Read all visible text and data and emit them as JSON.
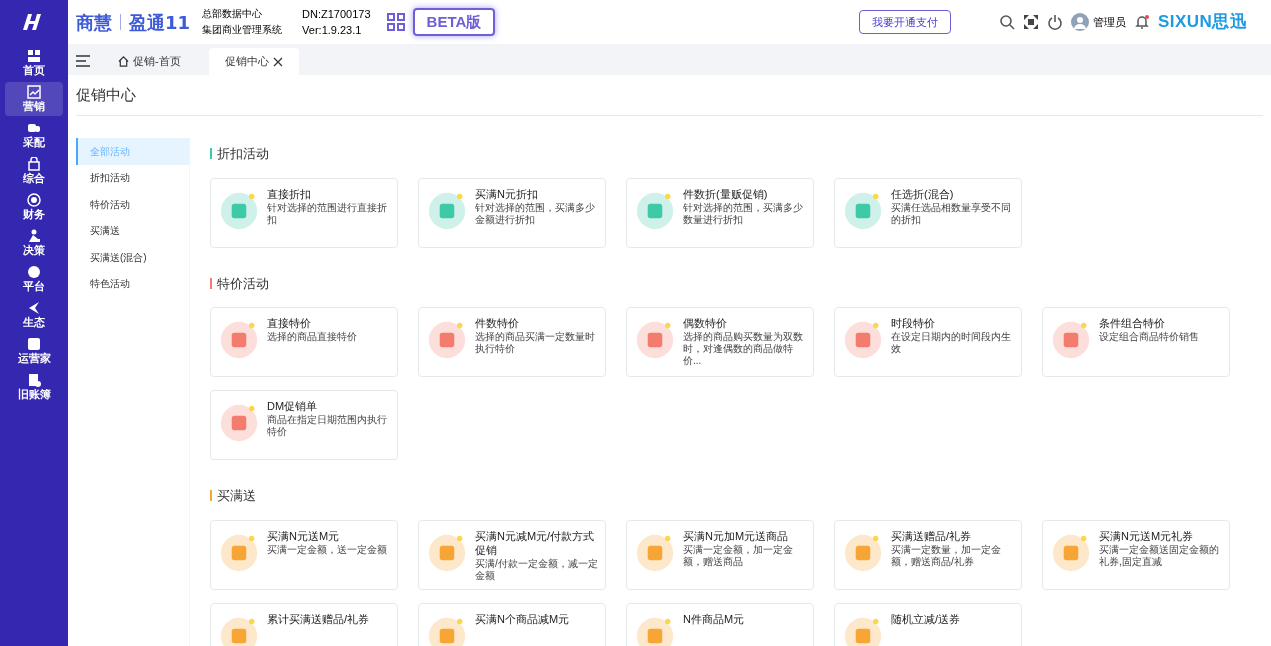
{
  "brand": {
    "name": "商慧",
    "product": "盈通11",
    "line1": "总部数据中心",
    "line2": "集团商业管理系统",
    "dn": "DN:Z1700173",
    "version": "Ver:1.9.23.1",
    "beta": "BETA版",
    "pay_button": "我要开通支付",
    "user": "管理员",
    "logo": "SIXUN思迅"
  },
  "nav": [
    {
      "label": "首页",
      "selected": false
    },
    {
      "label": "营销",
      "selected": true
    },
    {
      "label": "采配",
      "selected": false
    },
    {
      "label": "综合",
      "selected": false
    },
    {
      "label": "财务",
      "selected": false
    },
    {
      "label": "决策",
      "selected": false
    },
    {
      "label": "平台",
      "selected": false
    },
    {
      "label": "生态",
      "selected": false
    },
    {
      "label": "运营家",
      "selected": false
    },
    {
      "label": "旧账簿",
      "selected": false
    }
  ],
  "tabs": [
    {
      "label": "促销-首页",
      "selected": false,
      "closable": false
    },
    {
      "label": "促销中心",
      "selected": true,
      "closable": true
    }
  ],
  "page_title": "促销中心",
  "menu": [
    {
      "label": "全部活动",
      "selected": true
    },
    {
      "label": "折扣活动",
      "selected": false
    },
    {
      "label": "特价活动",
      "selected": false
    },
    {
      "label": "买满送",
      "selected": false
    },
    {
      "label": "买满送(混合)",
      "selected": false
    },
    {
      "label": "特色活动",
      "selected": false
    }
  ],
  "sections": [
    {
      "title": "折扣活动",
      "color": "#3ec9a7",
      "cards": [
        {
          "title": "直接折扣",
          "desc": "针对选择的范围进行直接折扣"
        },
        {
          "title": "买满N元折扣",
          "desc": "针对选择的范围，买满多少金额进行折扣"
        },
        {
          "title": "件数折(量贩促销)",
          "desc": "针对选择的范围，买满多少数量进行折扣"
        },
        {
          "title": "任选折(混合)",
          "desc": "买满任选品相数量享受不同的折扣"
        }
      ]
    },
    {
      "title": "特价活动",
      "color": "#f47c6e",
      "cards": [
        {
          "title": "直接特价",
          "desc": "选择的商品直接特价"
        },
        {
          "title": "件数特价",
          "desc": "选择的商品买满一定数量时执行特价"
        },
        {
          "title": "偶数特价",
          "desc": "选择的商品购买数量为双数时，对逢偶数的商品做特价..."
        },
        {
          "title": "时段特价",
          "desc": "在设定日期内的时间段内生效"
        },
        {
          "title": "条件组合特价",
          "desc": "设定组合商品特价销售"
        },
        {
          "title": "DM促销单",
          "desc": "商品在指定日期范围内执行特价"
        }
      ]
    },
    {
      "title": "买满送",
      "color": "#f7a534",
      "cards": [
        {
          "title": "买满N元送M元",
          "desc": "买满一定金额，送一定金额"
        },
        {
          "title": "买满N元减M元/付款方式促销",
          "desc": "买满/付款一定金额，减一定金额"
        },
        {
          "title": "买满N元加M元送商品",
          "desc": "买满一定金额，加一定金额，赠送商品"
        },
        {
          "title": "买满送赠品/礼券",
          "desc": "买满一定数量，加一定金额，赠送商品/礼券"
        },
        {
          "title": "买满N元送M元礼券",
          "desc": "买满一定金额送固定金额的礼券,固定直减"
        },
        {
          "title": "累计买满送赠品/礼券"
        },
        {
          "title": "买满N个商品减M元"
        },
        {
          "title": "N件商品M元"
        },
        {
          "title": "随机立减/送券"
        }
      ]
    }
  ]
}
